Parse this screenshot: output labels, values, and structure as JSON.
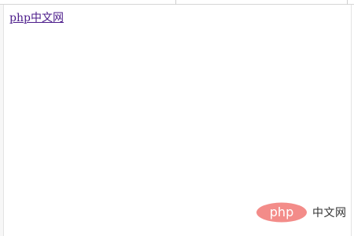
{
  "content": {
    "link_text": "php中文网"
  },
  "watermark": {
    "badge_text": "php",
    "site_text": "中文网"
  },
  "colors": {
    "link": "#4b1b8a",
    "watermark_badge": "#f38c89",
    "watermark_text": "#333333"
  }
}
